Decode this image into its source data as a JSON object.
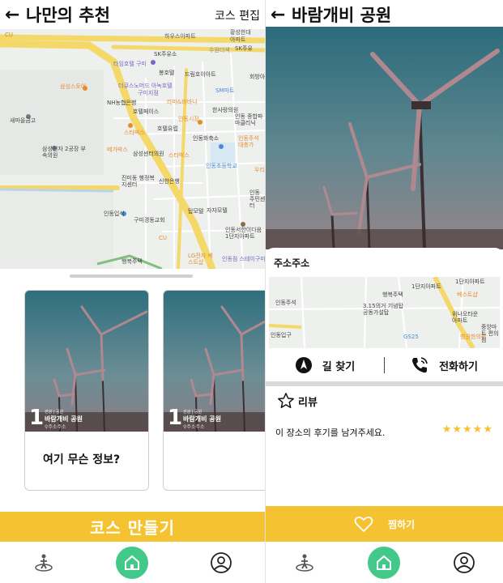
{
  "left": {
    "header": {
      "back": "←",
      "title": "나만의 추천",
      "edit": "코스 편집"
    },
    "map_labels": [
      {
        "id": "cu1",
        "text": "CU"
      },
      {
        "id": "hwa",
        "text": "하우스아파트"
      },
      {
        "id": "hwang",
        "text": "황성한대"
      },
      {
        "id": "apt",
        "text": "아파트"
      },
      {
        "id": "sk1",
        "text": "SK주유소"
      },
      {
        "id": "sk2",
        "text": "SK주유"
      },
      {
        "id": "suwon",
        "text": "수원더색"
      },
      {
        "id": "tayo",
        "text": "타임호텔 구미"
      },
      {
        "id": "bong",
        "text": "봉호텔"
      },
      {
        "id": "drim",
        "text": "드림호이아트"
      },
      {
        "id": "hoe",
        "text": "회방아"
      },
      {
        "id": "samsung",
        "text": "삼성스토어"
      },
      {
        "id": "duke",
        "text": "더큐스노머드 아녹호텔"
      },
      {
        "id": "gumi",
        "text": "구미지점"
      },
      {
        "id": "sm",
        "text": "SM마트"
      },
      {
        "id": "nh",
        "text": "NH농협은행"
      },
      {
        "id": "lamb",
        "text": "라마&바바나"
      },
      {
        "id": "hotelpace",
        "text": "호텔페이스"
      },
      {
        "id": "hansa",
        "text": "한사랑의원"
      },
      {
        "id": "saemaul",
        "text": "새마을금고"
      },
      {
        "id": "insta",
        "text": "인동시장"
      },
      {
        "id": "indong",
        "text": "인동 종합파마클리닉"
      },
      {
        "id": "star1",
        "text": "스타벅스"
      },
      {
        "id": "hyugel",
        "text": "호텔유럽"
      },
      {
        "id": "megabox",
        "text": "메가박스"
      },
      {
        "id": "indongwhoe",
        "text": "인동화축소"
      },
      {
        "id": "indongfl",
        "text": "인동주석 대충가"
      },
      {
        "id": "ssek",
        "text": "삼성전자 2공장 부속의원"
      },
      {
        "id": "ssclinic",
        "text": "삼성센터의원"
      },
      {
        "id": "star2",
        "text": "스타벅스"
      },
      {
        "id": "hakgyo",
        "text": "인동초등학교"
      },
      {
        "id": "jinmi",
        "text": "진미동 행정복지센터"
      },
      {
        "id": "shin",
        "text": "신한은행"
      },
      {
        "id": "wu",
        "text": "우리"
      },
      {
        "id": "indongpark",
        "text": "인동 주민센터"
      },
      {
        "id": "tapmo",
        "text": "탑모텔"
      },
      {
        "id": "jajang",
        "text": "자자모텔"
      },
      {
        "id": "indongip",
        "text": "인동입석"
      },
      {
        "id": "gumichurch",
        "text": "구미경동교회"
      },
      {
        "id": "cu2",
        "text": "CU"
      },
      {
        "id": "indongsh",
        "text": "인동서한이다음 1단지아파트"
      },
      {
        "id": "haengbok",
        "text": "행복주택"
      },
      {
        "id": "lg",
        "text": "LG전자 베스트샵"
      },
      {
        "id": "hdstar",
        "text": "인동점 스테이구미"
      }
    ],
    "cards": [
      {
        "rank": "1",
        "tag": "관광 | 공원",
        "name": "바람개비 공원",
        "addr": "주소주소",
        "info": "여기 무슨 정보?"
      },
      {
        "rank": "1",
        "tag": "관광 | 공원",
        "name": "바람개비 공원",
        "addr": "주소주소",
        "info": ""
      }
    ],
    "cta": "코스 만들기"
  },
  "right": {
    "header": {
      "back": "←",
      "title": "바람개비 공원"
    },
    "address": "주소주소",
    "map_labels": [
      {
        "id": "r1",
        "text": "1단지아파트"
      },
      {
        "id": "r2",
        "text": "1단지아파트"
      },
      {
        "id": "r3",
        "text": "베스트샵"
      },
      {
        "id": "r4",
        "text": "행복주택"
      },
      {
        "id": "r5",
        "text": "인동주석"
      },
      {
        "id": "r6",
        "text": "3.15의거 기념탑 공동가설탑"
      },
      {
        "id": "r7",
        "text": "위나오타운 아파트"
      },
      {
        "id": "r8",
        "text": "GS25"
      },
      {
        "id": "r9",
        "text": "병원한의원"
      },
      {
        "id": "r10",
        "text": "중앙마트 편의점"
      },
      {
        "id": "r11",
        "text": "인동입구"
      }
    ],
    "actions": {
      "directions": "길 찾기",
      "call": "전화하기"
    },
    "review": {
      "title": "리뷰",
      "prompt": "이 장소의 후기를 남겨주세요.",
      "stars": "★★★★★"
    },
    "like": "찜하기"
  },
  "colors": {
    "accent": "#f5c231",
    "home": "#42c98a",
    "road": "#f6e27a",
    "map_bg": "#eef0ee"
  },
  "icons": [
    "back-arrow-icon",
    "pin-icon",
    "navigation-icon",
    "phone-call-icon",
    "star-outline-icon",
    "heart-outline-icon",
    "map-walk-icon",
    "home-icon",
    "user-icon"
  ]
}
